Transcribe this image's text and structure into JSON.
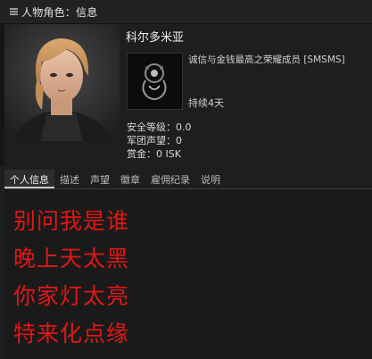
{
  "window": {
    "title": "人物角色：信息"
  },
  "character": {
    "name": "科尔多米亚",
    "corporation": "诚信与金钱最高之荣耀成员 [SMSMS]",
    "duration": "持续4天",
    "security_status": "安全等级：0.0",
    "faction_standing": "军团声望：0",
    "bounty": "赏金：0 ISK"
  },
  "tabs": [
    {
      "label": "个人信息",
      "active": true
    },
    {
      "label": "描述",
      "active": false
    },
    {
      "label": "声望",
      "active": false
    },
    {
      "label": "徽章",
      "active": false
    },
    {
      "label": "雇佣纪录",
      "active": false
    },
    {
      "label": "说明",
      "active": false
    }
  ],
  "bio": {
    "lines": [
      "别问我是谁",
      "晚上天太黑",
      "你家灯太亮",
      "特来化点缘"
    ],
    "color": "#e01717"
  },
  "icons": {
    "menu": "menu-icon",
    "corp_logo": "corp-emblem-icon"
  }
}
